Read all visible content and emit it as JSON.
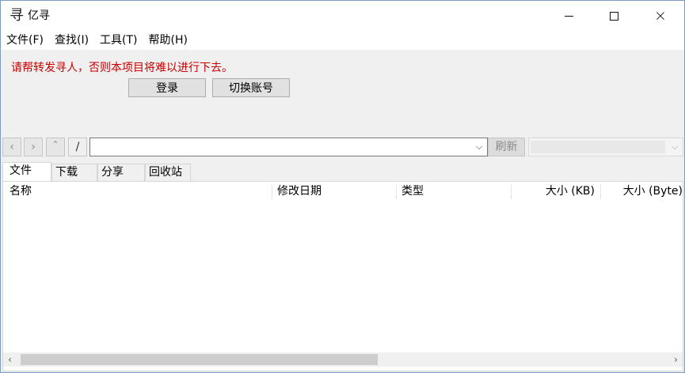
{
  "window": {
    "title": "亿寻",
    "icon": "app-calligraphy-icon",
    "controls": {
      "minimize": "minimize-icon",
      "maximize": "maximize-icon",
      "close": "×"
    }
  },
  "menu": [
    {
      "label": "文件(F)"
    },
    {
      "label": "查找(I)"
    },
    {
      "label": "工具(T)"
    },
    {
      "label": "帮助(H)"
    }
  ],
  "notice": {
    "text": "请帮转发寻人，否则本项目将难以进行下去。",
    "color": "#c80000"
  },
  "account": {
    "login_label": "登录",
    "switch_label": "切换账号"
  },
  "nav": {
    "back": "‹",
    "forward": "›",
    "up": "ˆ",
    "root": "/",
    "path_value": "",
    "dropdown_arrow": "⌵",
    "refresh_label": "刷新"
  },
  "tabs": [
    {
      "label": "文件",
      "active": true
    },
    {
      "label": "下载",
      "active": false
    },
    {
      "label": "分享",
      "active": false
    },
    {
      "label": "回收站",
      "active": false
    }
  ],
  "columns": {
    "name": "名称",
    "modified": "修改日期",
    "type": "类型",
    "size_kb": "大小 (KB)",
    "size_byte": "大小 (Byte)"
  },
  "rows": [],
  "scrollbar": {
    "left": "‹",
    "right": "›"
  }
}
